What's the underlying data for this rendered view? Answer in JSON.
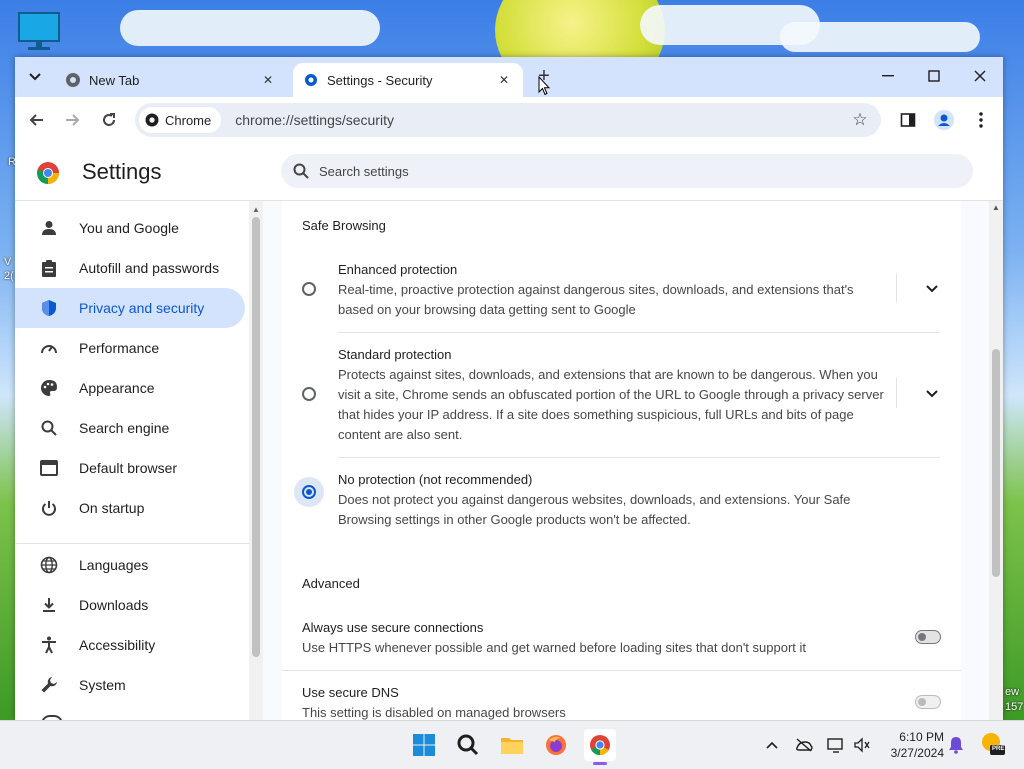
{
  "desktop": {
    "side_fragments": [
      "R",
      "V",
      "2("
    ],
    "right_fragments": [
      "ew",
      "157"
    ]
  },
  "browser": {
    "tabs": [
      {
        "title": "New Tab",
        "active": false
      },
      {
        "title": "Settings - Security",
        "active": true
      }
    ],
    "omnibox": {
      "chip_label": "Chrome",
      "url": "chrome://settings/security"
    }
  },
  "settings": {
    "title": "Settings",
    "search_placeholder": "Search settings",
    "sidebar": {
      "items": [
        {
          "label": "You and Google",
          "icon": "person-icon"
        },
        {
          "label": "Autofill and passwords",
          "icon": "clipboard-icon"
        },
        {
          "label": "Privacy and security",
          "icon": "shield-icon",
          "selected": true
        },
        {
          "label": "Performance",
          "icon": "speedometer-icon"
        },
        {
          "label": "Appearance",
          "icon": "palette-icon"
        },
        {
          "label": "Search engine",
          "icon": "search-icon"
        },
        {
          "label": "Default browser",
          "icon": "browser-window-icon"
        },
        {
          "label": "On startup",
          "icon": "power-icon"
        },
        {
          "label": "Languages",
          "icon": "globe-icon"
        },
        {
          "label": "Downloads",
          "icon": "download-icon"
        },
        {
          "label": "Accessibility",
          "icon": "accessibility-icon"
        },
        {
          "label": "System",
          "icon": "wrench-icon"
        }
      ]
    },
    "safe_browsing": {
      "section_title": "Safe Browsing",
      "options": [
        {
          "title": "Enhanced protection",
          "description": "Real-time, proactive protection against dangerous sites, downloads, and extensions that's based on your browsing data getting sent to Google",
          "selected": false
        },
        {
          "title": "Standard protection",
          "description": "Protects against sites, downloads, and extensions that are known to be dangerous. When you visit a site, Chrome sends an obfuscated portion of the URL to Google through a privacy server that hides your IP address. If a site does something suspicious, full URLs and bits of page content are also sent.",
          "selected": false
        },
        {
          "title": "No protection (not recommended)",
          "description": "Does not protect you against dangerous websites, downloads, and extensions. Your Safe Browsing settings in other Google products won't be affected.",
          "selected": true
        }
      ]
    },
    "advanced": {
      "section_title": "Advanced",
      "items": [
        {
          "title": "Always use secure connections",
          "description": "Use HTTPS whenever possible and get warned before loading sites that don't support it",
          "enabled": false
        },
        {
          "title": "Use secure DNS",
          "description": "This setting is disabled on managed browsers",
          "enabled": false,
          "disabled": true
        }
      ]
    }
  },
  "taskbar": {
    "time": "6:10 PM",
    "date": "3/27/2024",
    "badge": "PRE"
  },
  "colors": {
    "accent": "#0b57d0",
    "tabstrip": "#d3e3fd",
    "sidebar_selected": "#d3e3fd"
  }
}
